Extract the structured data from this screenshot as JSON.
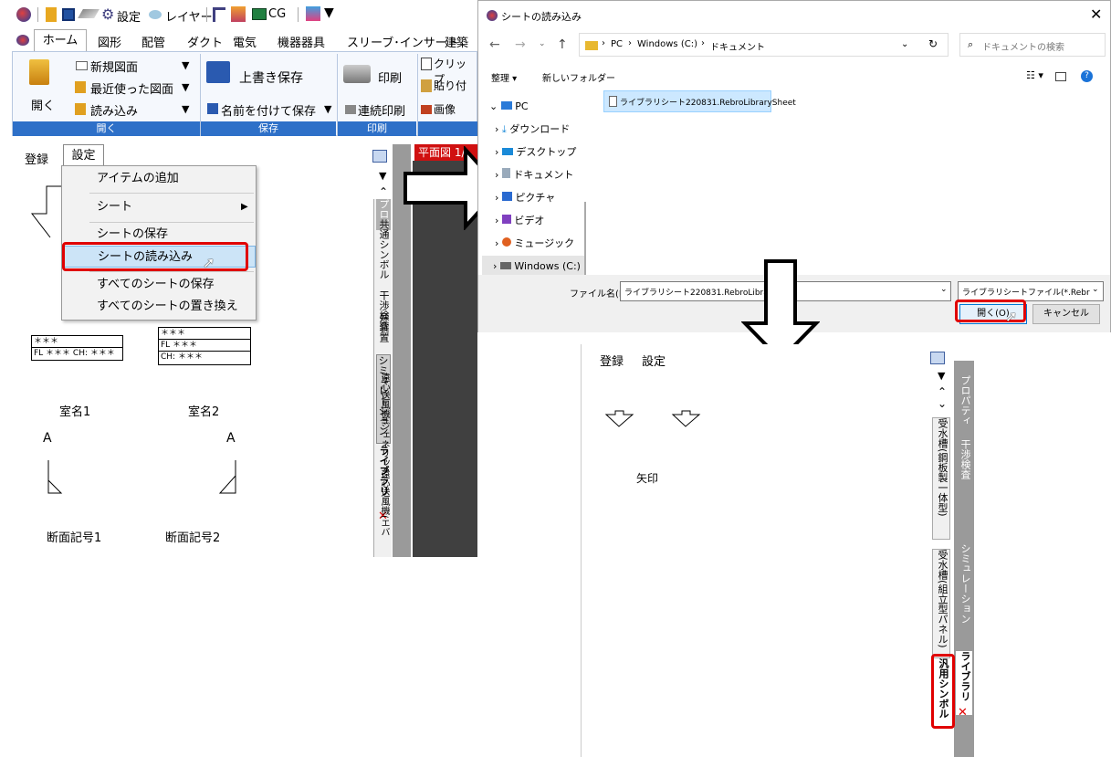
{
  "qat": {
    "settings": "設定",
    "layer": "レイヤー",
    "cg": "CG"
  },
  "ribbon_tabs": [
    "ホーム",
    "図形",
    "配管",
    "ダクト",
    "電気",
    "機器器具",
    "スリーブ･インサート",
    "建築"
  ],
  "ribbon": {
    "open": "開く",
    "new_drawing": "新規図面",
    "recent": "最近使った図面",
    "load": "読み込み",
    "overwrite_save": "上書き保存",
    "save_as": "名前を付けて保存",
    "print": "印刷",
    "continuous_print": "連続印刷",
    "clip": "クリップ",
    "paste": "貼り付",
    "image": "画像",
    "group_open": "開く",
    "group_save": "保存",
    "group_print": "印刷"
  },
  "left_panel": {
    "tab_register": "登録",
    "tab_settings": "設定",
    "plan_label": "平面図 1/"
  },
  "context_menu": {
    "add_item": "アイテムの追加",
    "sheet": "シート",
    "save_sheet": "シートの保存",
    "load_sheet": "シートの読み込み",
    "save_all": "すべてのシートの保存",
    "replace_all": "すべてのシートの置き換え"
  },
  "symbols": {
    "stars": "＊＊＊",
    "fl_ch": "FL ＊＊＊ CH: ＊＊＊",
    "fl": "FL  ＊＊＊",
    "ch": "CH: ＊＊＊",
    "room1": "室名1",
    "room2": "室名2",
    "a1": "A",
    "a2": "A",
    "sec1": "断面記号1",
    "sec2": "断面記号2"
  },
  "left_vtabs": {
    "property": "プロパティ",
    "common_symbol": "共通シンボル",
    "interference": "干渉検査",
    "valve_device": "弁装置",
    "simulation": "シミュレーション",
    "centrifugal_generic": "遠心送風機(ジェネリック)",
    "library": "ライブラリ",
    "centrifugal_ep": "遠心送風機(エバ"
  },
  "dialog": {
    "title": "シートの読み込み",
    "path_pc": "PC",
    "path_windows": "Windows (C:)",
    "path_docs": "ドキュメント",
    "search_placeholder": "ドキュメントの検索",
    "organize": "整理 ▾",
    "new_folder": "新しいフォルダー",
    "tree": [
      "PC",
      "ダウンロード",
      "デスクトップ",
      "ドキュメント",
      "ピクチャ",
      "ビデオ",
      "ミュージック",
      "Windows (C:)"
    ],
    "file": "ライブラリシート220831.RebroLibrarySheet",
    "filename_label": "ファイル名(N):",
    "filename_value": "ライブラリシート220831.RebroLibrarySh",
    "filter": "ライブラリシートファイル(*.RebroLibr",
    "open_btn": "開く(O)",
    "cancel_btn": "キャンセル"
  },
  "result_panel": {
    "tab_register": "登録",
    "tab_settings": "設定",
    "item_label": "矢印",
    "vtabs": {
      "property": "プロパティ",
      "water_tank1": "受水槽(鋼板製一体型)",
      "interference": "干渉検査",
      "water_tank2": "受水槽(組立型パネル)",
      "simulation": "シミュレーション",
      "library": "ライブラリ",
      "generic_symbol": "汎用シンボル"
    }
  }
}
